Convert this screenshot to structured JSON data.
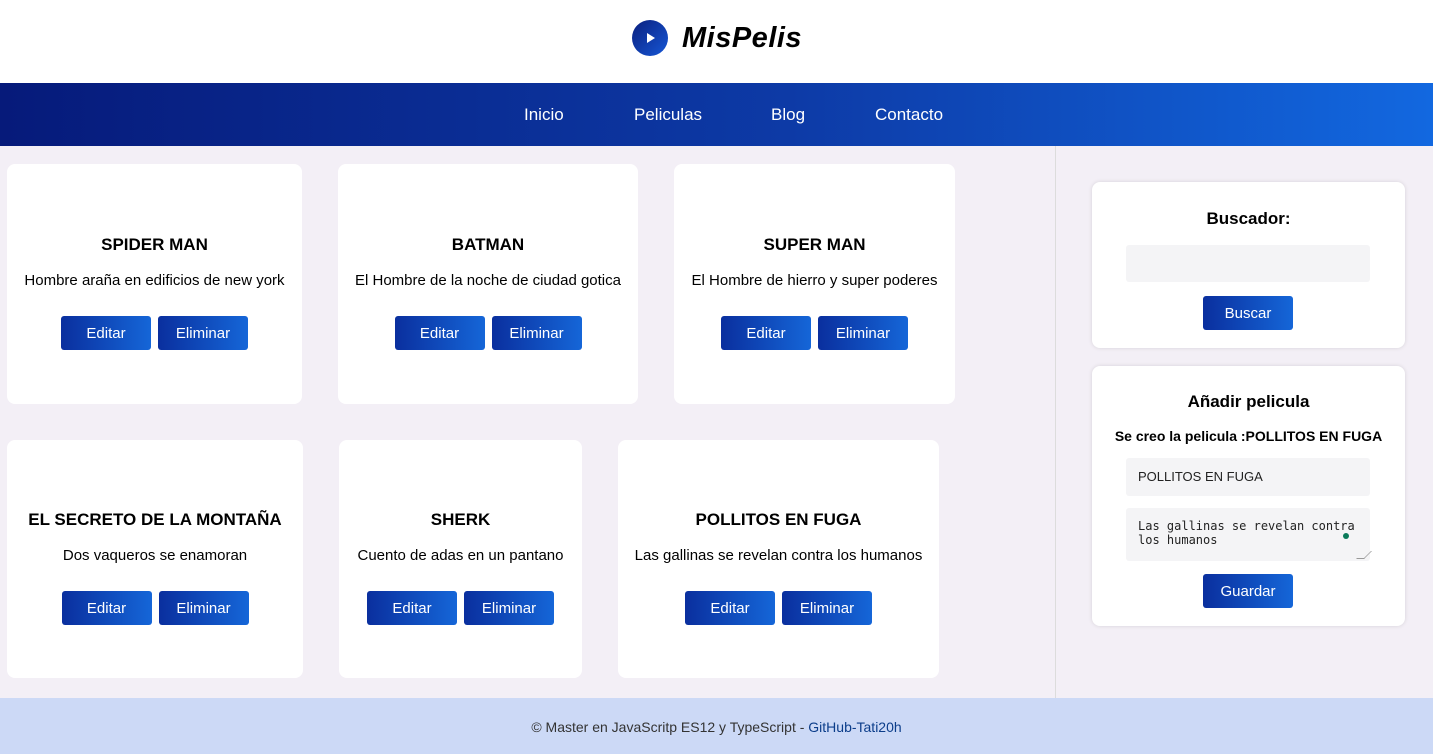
{
  "header": {
    "logo_text": "MisPelis"
  },
  "nav": {
    "items": [
      "Inicio",
      "Peliculas",
      "Blog",
      "Contacto"
    ]
  },
  "movies": [
    {
      "title": "SPIDER MAN",
      "description": "Hombre araña en edificios de new york"
    },
    {
      "title": "BATMAN",
      "description": "El Hombre de la noche de ciudad gotica"
    },
    {
      "title": "SUPER MAN",
      "description": "El Hombre de hierro y super poderes"
    },
    {
      "title": "EL SECRETO DE LA MONTAÑA",
      "description": "Dos vaqueros se enamoran"
    },
    {
      "title": "SHERK",
      "description": "Cuento de adas en un pantano"
    },
    {
      "title": "POLLITOS EN FUGA",
      "description": "Las gallinas se revelan contra los humanos"
    }
  ],
  "card_buttons": {
    "edit": "Editar",
    "delete": "Eliminar"
  },
  "search": {
    "title": "Buscador:",
    "value": "",
    "button": "Buscar"
  },
  "add_movie": {
    "title": "Añadir pelicula",
    "message": "Se creo la pelicula :POLLITOS EN FUGA",
    "title_value": "POLLITOS EN FUGA",
    "description_value": "Las gallinas se revelan contra los humanos",
    "button": "Guardar"
  },
  "footer": {
    "text": "© Master en JavaScritp ES12 y TypeScript - ",
    "link": "GitHub-Tati20h"
  },
  "colors": {
    "accent_dark": "#061a7a",
    "accent_light": "#1268e0",
    "background": "#f3eff6",
    "footer_bg": "#ccd9f6"
  }
}
